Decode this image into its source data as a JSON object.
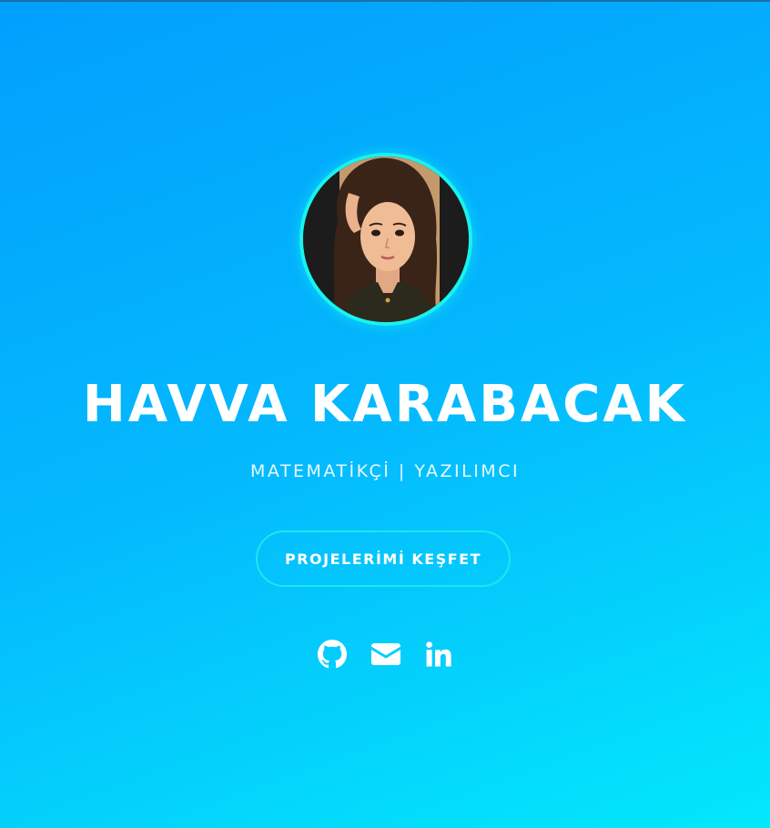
{
  "hero": {
    "name": "HAVVA KARABACAK",
    "subtitle": "MATEMATİKÇİ | YAZILIMCI",
    "cta_label": "PROJELERİMİ KEŞFET"
  },
  "avatar": {
    "icon": "portrait-illustration"
  },
  "social": [
    {
      "icon": "github-icon"
    },
    {
      "icon": "envelope-icon"
    },
    {
      "icon": "linkedin-icon"
    }
  ],
  "colors": {
    "gradient_start": "#029ffd",
    "gradient_end": "#03e8fc",
    "accent": "#18f3ee",
    "text": "#ffffff"
  }
}
